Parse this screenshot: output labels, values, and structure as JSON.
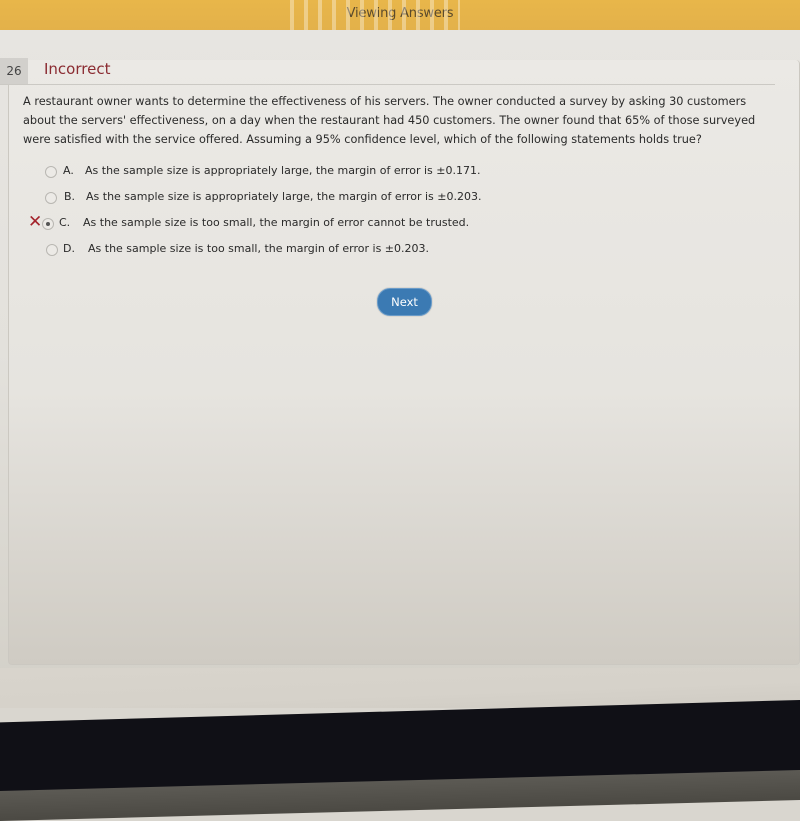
{
  "header": {
    "title": "Viewing Answers"
  },
  "question": {
    "number": "26",
    "status": "Incorrect",
    "text": "A restaurant owner wants to determine the effectiveness of his servers. The owner conducted a survey by asking 30 customers about the servers' effectiveness, on a day when the restaurant had 450 customers. The owner found that 65% of those surveyed were satisfied with the service offered. Assuming a 95% confidence level, which of the following statements holds true?",
    "options": [
      {
        "letter": "A.",
        "text": "As the sample size is appropriately large, the margin of error is ±0.171.",
        "selected": false
      },
      {
        "letter": "B.",
        "text": "As the sample size is appropriately large, the margin of error is ±0.203.",
        "selected": false
      },
      {
        "letter": "C.",
        "text": "As the sample size is too small, the margin of error cannot be trusted.",
        "selected": true,
        "marked_incorrect": true
      },
      {
        "letter": "D.",
        "text": "As the sample size is too small, the margin of error is ±0.203.",
        "selected": false
      }
    ],
    "incorrect_mark": "✕"
  },
  "actions": {
    "next_label": "Next"
  },
  "colors": {
    "header_bg": "#e3b14a",
    "incorrect": "#8b2c32",
    "button": "#3b7ab3"
  }
}
